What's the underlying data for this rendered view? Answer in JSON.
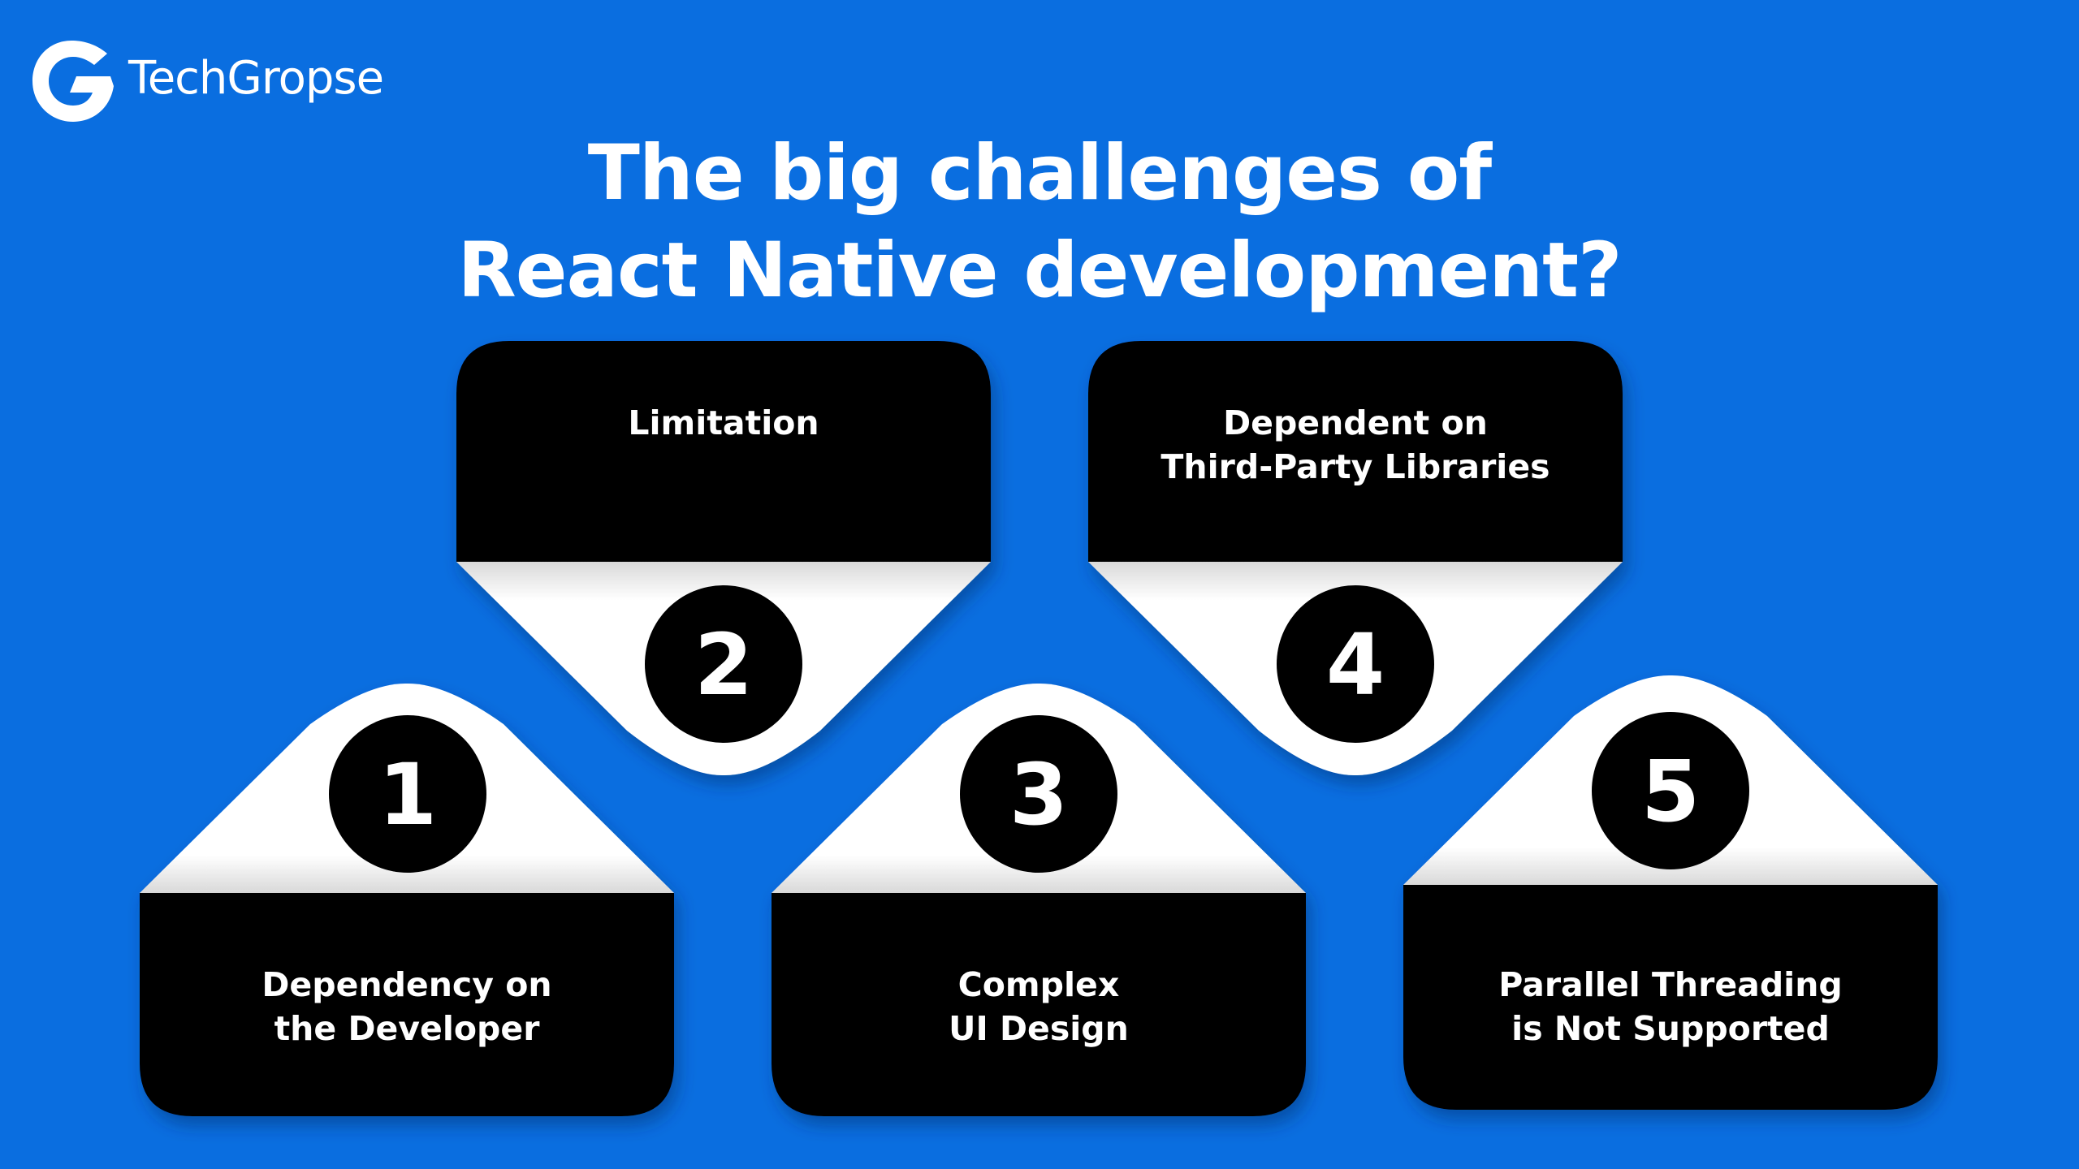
{
  "brand": {
    "name": "TechGropse"
  },
  "title": {
    "line1": "The big challenges of",
    "line2": "React Native development?"
  },
  "colors": {
    "background": "#0a6ee0",
    "card": "#000000",
    "cap": "#ffffff",
    "text": "#ffffff"
  },
  "challenges": [
    {
      "number": "1",
      "lines": [
        "Dependency on",
        "the Developer"
      ]
    },
    {
      "number": "2",
      "lines": [
        "Limitation"
      ]
    },
    {
      "number": "3",
      "lines": [
        "Complex",
        "UI Design"
      ]
    },
    {
      "number": "4",
      "lines": [
        "Dependent on",
        "Third-Party Libraries"
      ]
    },
    {
      "number": "5",
      "lines": [
        "Parallel Threading",
        "is Not Supported"
      ]
    }
  ]
}
